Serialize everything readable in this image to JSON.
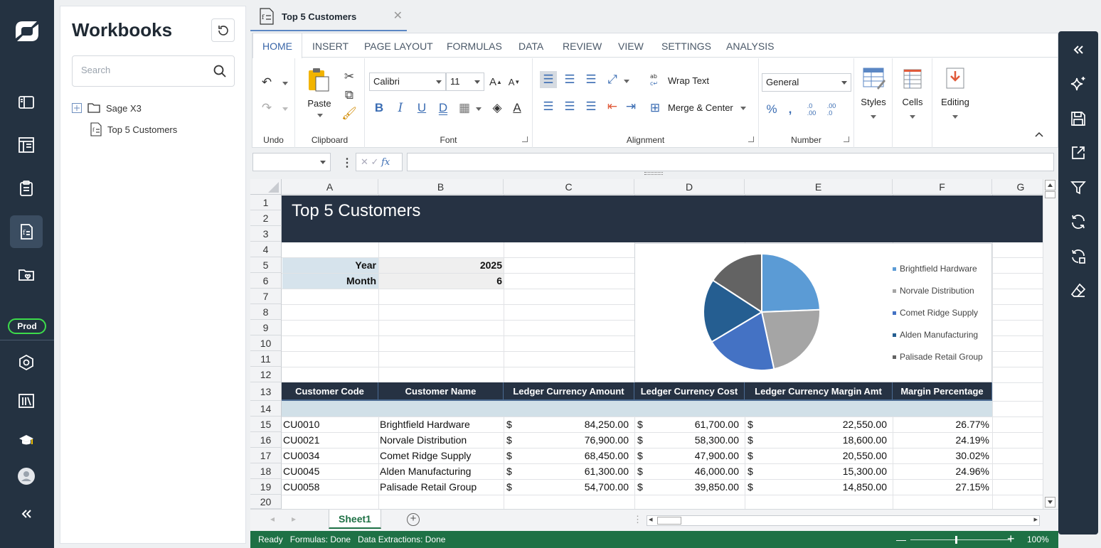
{
  "nav": {
    "env_label": "Prod"
  },
  "workbooks": {
    "title": "Workbooks",
    "search_placeholder": "Search",
    "tree": [
      {
        "label": "Sage X3",
        "type": "folder"
      },
      {
        "label": "Top 5 Customers",
        "type": "workbook"
      }
    ]
  },
  "document_tab": {
    "label": "Top 5 Customers"
  },
  "ribbon": {
    "tabs": [
      "HOME",
      "INSERT",
      "PAGE LAYOUT",
      "FORMULAS",
      "DATA",
      "REVIEW",
      "VIEW",
      "SETTINGS",
      "ANALYSIS"
    ],
    "active_tab": "HOME",
    "groups": {
      "undo": "Undo",
      "clipboard": "Clipboard",
      "paste": "Paste",
      "font": "Font",
      "alignment": "Alignment",
      "number": "Number",
      "wrap_text": "Wrap Text",
      "merge_center": "Merge & Center",
      "styles": "Styles",
      "cells": "Cells",
      "editing": "Editing"
    },
    "font_name": "Calibri",
    "font_size": "11",
    "number_format": "General"
  },
  "sheet": {
    "columns": [
      "A",
      "B",
      "C",
      "D",
      "E",
      "F",
      "G"
    ],
    "rows": [
      "1",
      "2",
      "3",
      "4",
      "5",
      "6",
      "7",
      "8",
      "9",
      "10",
      "11",
      "12",
      "13",
      "14",
      "15",
      "16",
      "17",
      "18",
      "19",
      "20"
    ],
    "title": "Top 5 Customers",
    "params": [
      {
        "label": "Year",
        "value": "2025"
      },
      {
        "label": "Month",
        "value": "6"
      }
    ],
    "headers": [
      "Customer Code",
      "Customer Name",
      "Ledger Currency Amount",
      "Ledger Currency Cost",
      "Ledger Currency Margin Amt",
      "Margin Percentage"
    ],
    "currency_symbol": "$",
    "data": [
      {
        "code": "CU0010",
        "name": "Brightfield Hardware",
        "amount": "84,250.00",
        "cost": "61,700.00",
        "margin": "22,550.00",
        "pct": "26.77%"
      },
      {
        "code": "CU0021",
        "name": "Norvale Distribution",
        "amount": "76,900.00",
        "cost": "58,300.00",
        "margin": "18,600.00",
        "pct": "24.19%"
      },
      {
        "code": "CU0034",
        "name": "Comet Ridge Supply",
        "amount": "68,450.00",
        "cost": "47,900.00",
        "margin": "20,550.00",
        "pct": "30.02%"
      },
      {
        "code": "CU0045",
        "name": "Alden Manufacturing",
        "amount": "61,300.00",
        "cost": "46,000.00",
        "margin": "15,300.00",
        "pct": "24.96%"
      },
      {
        "code": "CU0058",
        "name": "Palisade Retail Group",
        "amount": "54,700.00",
        "cost": "39,850.00",
        "margin": "14,850.00",
        "pct": "27.15%"
      }
    ],
    "sheet_tab": "Sheet1"
  },
  "chart_data": {
    "type": "pie",
    "categories": [
      "Brightfield Hardware",
      "Norvale Distribution",
      "Comet Ridge Supply",
      "Alden Manufacturing",
      "Palisade Retail Group"
    ],
    "values": [
      84250,
      76900,
      68450,
      61300,
      54700
    ],
    "colors": [
      "#5b9bd5",
      "#a5a5a5",
      "#4472c4",
      "#255e91",
      "#636363"
    ],
    "legend_position": "right"
  },
  "status": {
    "text": "Ready   Formulas: Done   Data Extractions: Done",
    "zoom": "100%"
  }
}
